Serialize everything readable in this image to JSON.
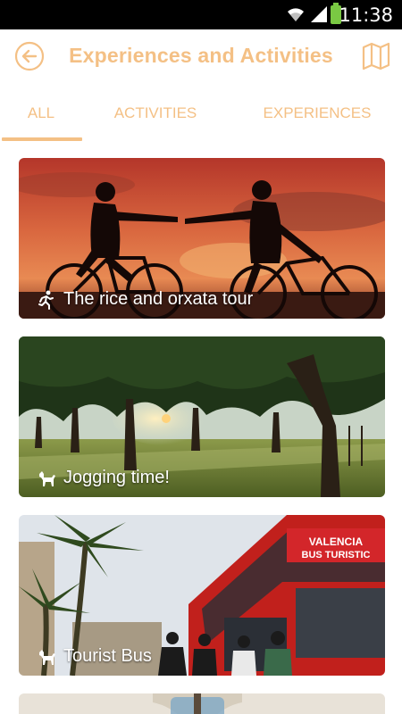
{
  "status_bar": {
    "time": "11:38",
    "icons": [
      "wifi-icon",
      "signal-icon",
      "battery-icon"
    ]
  },
  "header": {
    "title": "Experiences and Activities",
    "back_icon": "back-arrow-icon",
    "map_icon": "map-icon",
    "accent_color": "#f4c085"
  },
  "tabs": [
    {
      "label": "ALL",
      "selected": true
    },
    {
      "label": "ACTIVITIES",
      "selected": false
    },
    {
      "label": "EXPERIENCES",
      "selected": false
    }
  ],
  "cards": [
    {
      "title": "The rice and orxata tour",
      "category_icon": "runner-icon"
    },
    {
      "title": "Jogging time!",
      "category_icon": "horse-icon"
    },
    {
      "title": "Tourist Bus",
      "category_icon": "horse-icon"
    }
  ],
  "images": {
    "bus_sign_line1": "VALENCIA",
    "bus_sign_line2": "BUS TURISTIC"
  }
}
